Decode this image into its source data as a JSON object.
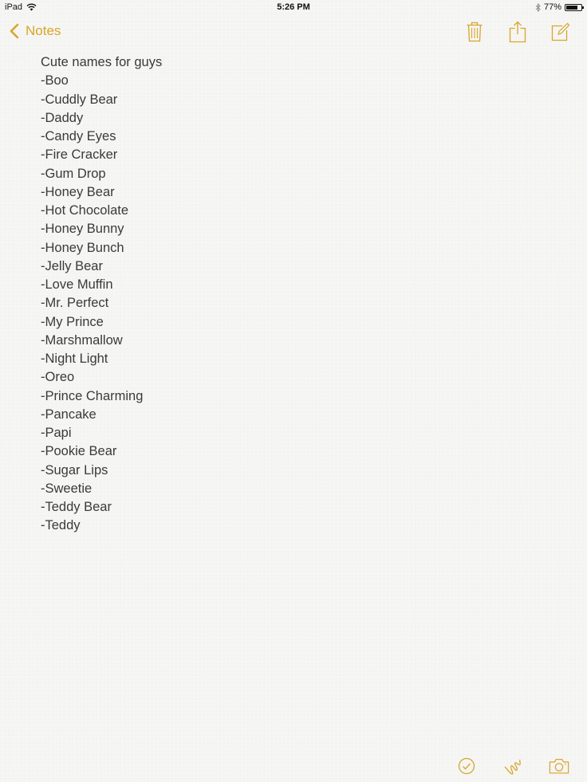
{
  "status_bar": {
    "device": "iPad",
    "time": "5:26 PM",
    "battery_percent": "77%",
    "battery_level": 0.77
  },
  "nav": {
    "back_label": "Notes",
    "accent_color": "#d8a62a",
    "icons": [
      "trash-icon",
      "share-icon",
      "compose-icon"
    ]
  },
  "note": {
    "title": "Cute names for guys",
    "lines": [
      "-Boo",
      "-Cuddly Bear",
      "-Daddy",
      "-Candy Eyes",
      "-Fire Cracker",
      "-Gum Drop",
      "-Honey Bear",
      "-Hot Chocolate",
      "-Honey Bunny",
      "-Honey Bunch",
      "-Jelly Bear",
      "-Love Muffin",
      "-Mr. Perfect",
      "-My Prince",
      "-Marshmallow",
      "-Night Light",
      "-Oreo",
      "-Prince Charming",
      "-Pancake",
      "-Papi",
      "-Pookie Bear",
      "-Sugar Lips",
      "-Sweetie",
      "-Teddy Bear",
      "-Teddy"
    ]
  },
  "bottom_toolbar": {
    "icons": [
      "checklist-icon",
      "sketch-icon",
      "camera-icon"
    ]
  }
}
